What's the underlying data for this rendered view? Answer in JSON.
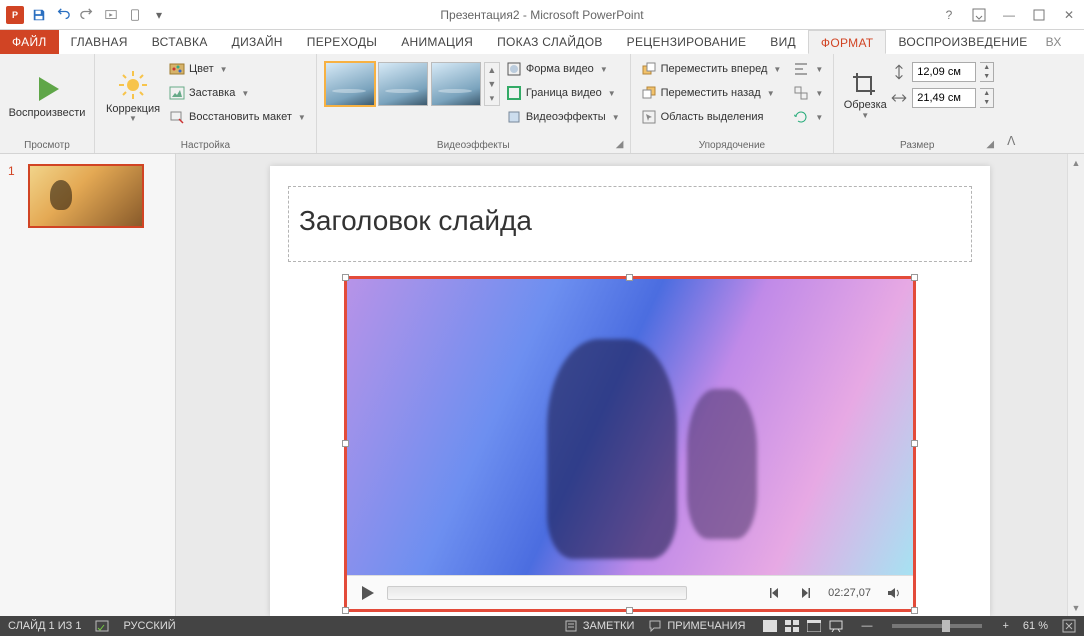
{
  "app": {
    "title": "Презентация2 - Microsoft PowerPoint"
  },
  "tabs": {
    "file": "ФАЙЛ",
    "home": "ГЛАВНАЯ",
    "insert": "ВСТАВКА",
    "design": "ДИЗАЙН",
    "transitions": "ПЕРЕХОДЫ",
    "animations": "АНИМАЦИЯ",
    "slideshow": "ПОКАЗ СЛАЙДОВ",
    "review": "РЕЦЕНЗИРОВАНИЕ",
    "view": "ВИД",
    "format": "ФОРМАТ",
    "playback": "ВОСПРОИЗВЕДЕНИЕ",
    "overflow": "Вх"
  },
  "ribbon": {
    "preview": {
      "play": "Воспроизвести",
      "label": "Просмотр"
    },
    "adjust": {
      "corrections": "Коррекция",
      "color": "Цвет",
      "poster": "Заставка",
      "reset": "Восстановить макет",
      "label": "Настройка"
    },
    "styles": {
      "shape": "Форма видео",
      "border": "Граница видео",
      "effects": "Видеоэффекты",
      "label": "Видеоэффекты"
    },
    "arrange": {
      "forward": "Переместить вперед",
      "backward": "Переместить назад",
      "selection": "Область выделения",
      "label": "Упорядочение"
    },
    "size": {
      "crop": "Обрезка",
      "height": "12,09 см",
      "width": "21,49 см",
      "label": "Размер"
    }
  },
  "slide": {
    "thumb_number": "1",
    "title_placeholder": "Заголовок слайда",
    "video": {
      "time": "02:27,07"
    }
  },
  "status": {
    "slide_counter": "СЛАЙД 1 ИЗ 1",
    "language": "РУССКИЙ",
    "notes": "ЗАМЕТКИ",
    "comments": "ПРИМЕЧАНИЯ",
    "zoom": "61 %"
  }
}
